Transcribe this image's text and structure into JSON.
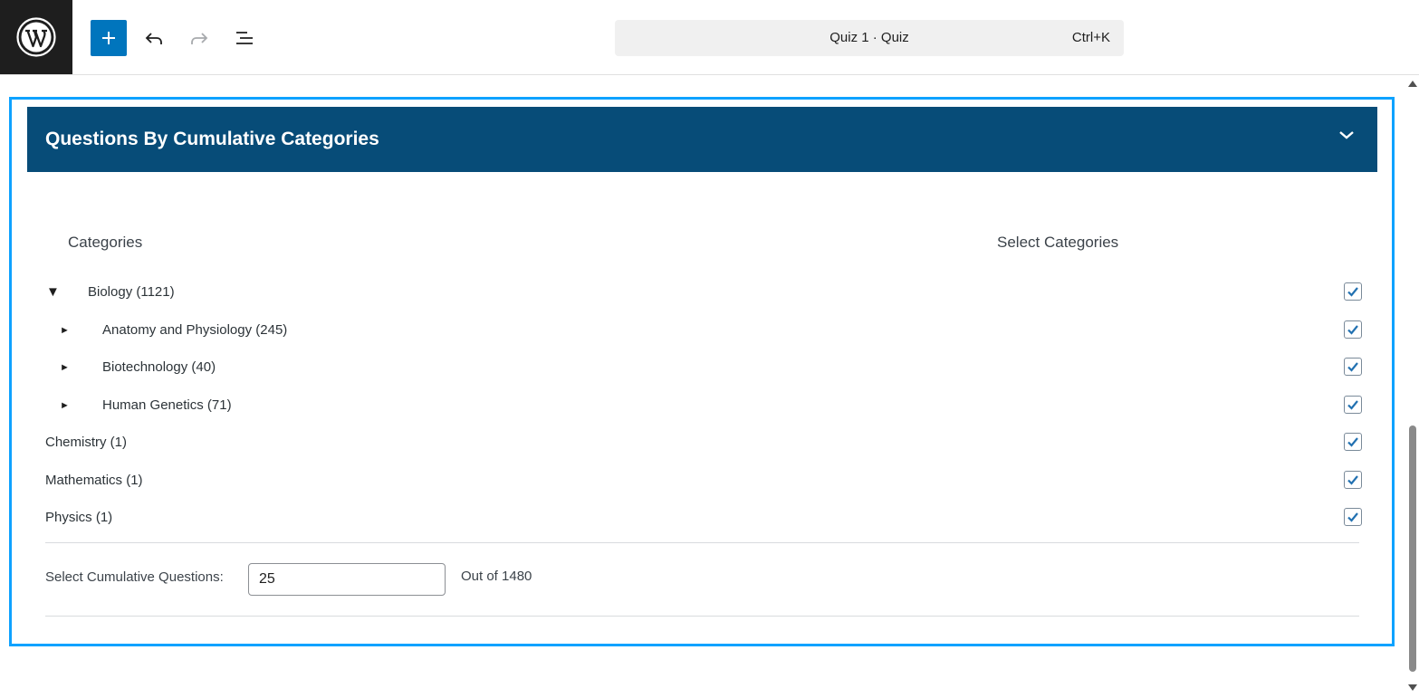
{
  "toolbar": {
    "add_label": "+",
    "command_bar": {
      "title": "Quiz 1 · Quiz",
      "shortcut": "Ctrl+K"
    }
  },
  "panel": {
    "title": "Questions By Cumulative Categories",
    "column_categories": "Categories",
    "column_select": "Select Categories",
    "categories": [
      {
        "label": "Biology (1121)",
        "toggle": "▼",
        "checked": true
      },
      {
        "label": "Anatomy and Physiology (245)",
        "toggle": "►",
        "checked": true
      },
      {
        "label": "Biotechnology (40)",
        "toggle": "►",
        "checked": true
      },
      {
        "label": "Human Genetics (71)",
        "toggle": "►",
        "checked": true
      },
      {
        "label": "Chemistry (1)",
        "checked": true
      },
      {
        "label": "Mathematics (1)",
        "checked": true
      },
      {
        "label": "Physics (1)",
        "checked": true
      }
    ],
    "cumulative": {
      "label": "Select Cumulative Questions:",
      "value": "25",
      "out_of": "Out of 1480"
    }
  },
  "colors": {
    "header_bg": "#074c78",
    "accent": "#0075bd",
    "block_border": "#0ea2ff"
  },
  "icons": [
    "wordpress-logo-icon",
    "plus-icon",
    "undo-icon",
    "redo-icon",
    "document-overview-icon",
    "chevron-down-icon",
    "checkmark-icon"
  ]
}
